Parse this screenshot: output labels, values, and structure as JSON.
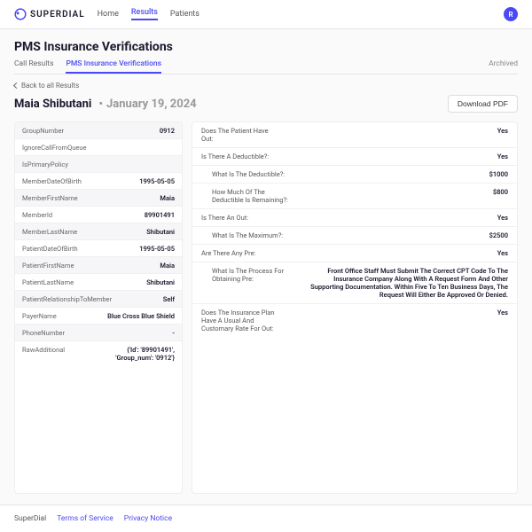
{
  "brand": "SUPERDIAL",
  "nav": {
    "home": "Home",
    "results": "Results",
    "patients": "Patients"
  },
  "avatar_letter": "R",
  "page_title": "PMS Insurance Verifications",
  "tabs": {
    "call_results": "Call Results",
    "pms": "PMS Insurance Verifications",
    "archived": "Archived"
  },
  "back_link": "Back to all Results",
  "record": {
    "name": "Maia Shibutani",
    "date": "January 19, 2024"
  },
  "download_label": "Download PDF",
  "side": [
    {
      "k": "GroupNumber",
      "v": "0912"
    },
    {
      "k": "IgnoreCallFromQueue",
      "v": ""
    },
    {
      "k": "IsPrimaryPolicy",
      "v": ""
    },
    {
      "k": "MemberDateOfBirth",
      "v": "1995-05-05"
    },
    {
      "k": "MemberFirstName",
      "v": "Maia"
    },
    {
      "k": "MemberId",
      "v": "89901491"
    },
    {
      "k": "MemberLastName",
      "v": "Shibutani"
    },
    {
      "k": "PatientDateOfBirth",
      "v": "1995-05-05"
    },
    {
      "k": "PatientFirstName",
      "v": "Maia"
    },
    {
      "k": "PatientLastName",
      "v": "Shibutani"
    },
    {
      "k": "PatientRelationshipToMember",
      "v": "Self"
    },
    {
      "k": "PayerName",
      "v": "Blue Cross Blue Shield"
    },
    {
      "k": "PhoneNumber",
      "v": "-"
    },
    {
      "k": "RawAdditional",
      "v": "{'Id': '89901491', 'Group_num': '0912'}"
    }
  ],
  "results": [
    {
      "q": "Does The Patient Have Out:",
      "a": "Yes",
      "indent": false
    },
    {
      "q": "Is There A Deductible?:",
      "a": "Yes",
      "indent": false
    },
    {
      "q": "What Is The Deductible?:",
      "a": "$1000",
      "indent": true
    },
    {
      "q": "How Much Of The Deductible Is Remaining?:",
      "a": "$800",
      "indent": true
    },
    {
      "q": "Is There An Out:",
      "a": "Yes",
      "indent": false
    },
    {
      "q": "What Is The Maximum?:",
      "a": "$2500",
      "indent": true
    },
    {
      "q": "Are There Any Pre:",
      "a": "Yes",
      "indent": false
    },
    {
      "q": "What Is The Process For Obtaining Pre:",
      "a": "Front Office Staff Must Submit The Correct CPT Code To The Insurance Company Along With A Request Form And Other Supporting Documentation. Within Five To Ten Business Days, The Request Will Either Be Approved Or Denied.",
      "indent": true
    },
    {
      "q": "Does The Insurance Plan Have A Usual And Customary Rate For Out:",
      "a": "Yes",
      "indent": false
    }
  ],
  "footer": {
    "brand": "SuperDial",
    "tos": "Terms of Service",
    "privacy": "Privacy Notice"
  }
}
